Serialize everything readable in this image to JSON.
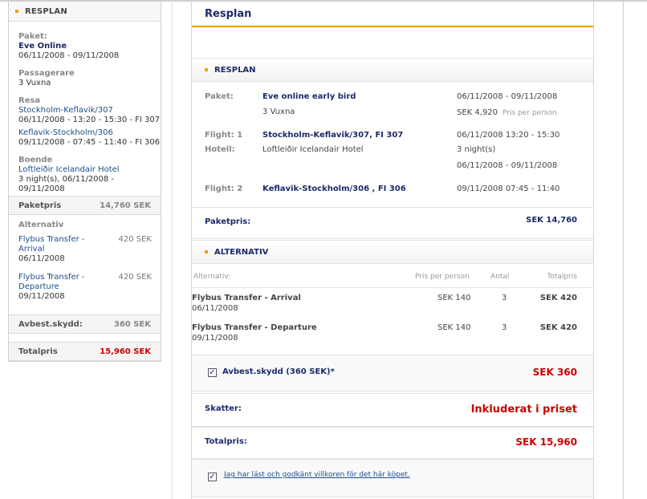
{
  "sidebar": {
    "title": "RESPLAN",
    "paket_label": "Paket:",
    "paket_name": "Eve Online",
    "paket_dates": "06/11/2008 - 09/11/2008",
    "passagerare_label": "Passagerare",
    "passagerare_val": "3 Vuxna",
    "resa_label": "Resa",
    "resa1_link": "Stockholm-Keflavik/307",
    "resa1_time": "06/11/2008 - 13:20 - 15:30 - FI 307",
    "resa2_link": "Keflavik-Stockholm/306",
    "resa2_time": "09/11/2008 - 07:45 - 11:40 - FI 306",
    "boende_label": "Boende",
    "boende_link": "Loftleiðir Icelandair Hotel",
    "boende_val": "3 night(s), 06/11/2008 - 09/11/2008",
    "paketpris_label": "Paketpris",
    "paketpris_val": "14,760 SEK",
    "alternativ_label": "Alternativ",
    "alt1_line1": "Flybus Transfer -",
    "alt1_line2": "Arrival",
    "alt1_date": "06/11/2008",
    "alt1_price": "420 SEK",
    "alt2_line1": "Flybus Transfer -",
    "alt2_line2": "Departure",
    "alt2_date": "09/11/2008",
    "alt2_price": "420 SEK",
    "avbest_label": "Avbest.skydd:",
    "avbest_val": "360 SEK",
    "totalpris_label": "Totalpris",
    "totalpris_val": "15,960 SEK"
  },
  "main": {
    "title": "Resplan",
    "resplan_head": "RESPLAN",
    "paket_label": "Paket:",
    "paket_name": "Eve online early bird",
    "paket_pax": "3 Vuxna",
    "paket_dates": "06/11/2008 - 09/11/2008",
    "paket_price": "SEK 4,920",
    "paket_pp": "Pris per person",
    "flight1_label": "Flight: 1",
    "flight1_route": "Stockholm-Keflavik/307, FI 307",
    "flight1_time": "06/11/2008 13:20 - 15:30",
    "hotel_label": "Hotell:",
    "hotel_name": "Loftleiðir Icelandair Hotel",
    "hotel_nights": "3 night(s)",
    "hotel_dates": "06/11/2008 - 09/11/2008",
    "flight2_label": "Flight: 2",
    "flight2_route": "Keflavik-Stockholm/306 , FI 306",
    "flight2_time": "09/11/2008 07:45 - 11:40",
    "paketpris_label": "Paketpris:",
    "paketpris_val": "SEK 14,760",
    "alternativ_head": "ALTERNATIV",
    "alt_table": {
      "headers": [
        "Alternativ:",
        "Pris per person",
        "Antal",
        "Totalpris"
      ],
      "rows": [
        {
          "name": "Flybus Transfer - Arrival",
          "date": "06/11/2008",
          "price": "SEK 140",
          "qty": "3",
          "total": "SEK 420"
        },
        {
          "name": "Flybus Transfer - Departure",
          "date": "09/11/2008",
          "price": "SEK 140",
          "qty": "3",
          "total": "SEK 420"
        }
      ]
    },
    "avbest_label": "Avbest.skydd (360 SEK)*",
    "avbest_val": "SEK 360",
    "skatter_label": "Skatter:",
    "skatter_val": "Inkluderat i priset",
    "totalpris_label": "Totalpris:",
    "totalpris_val": "SEK 15,960",
    "terms_link": "Jag har läst och godkänt villkoren för det här köpet."
  },
  "colors": {
    "accent": "#f0a000",
    "navy": "#1b2a6b",
    "red": "#cc0000"
  }
}
